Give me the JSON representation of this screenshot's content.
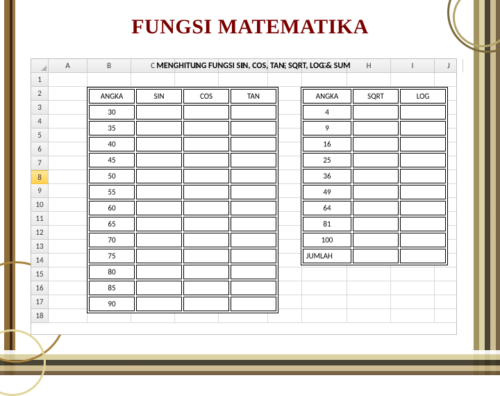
{
  "title": "FUNGSI MATEMATIKA",
  "sheet_subtitle": "MENGHITUNG FUNGSI SIN, COS, TAN, SQRT, LOG & SUM",
  "columns": [
    "A",
    "B",
    "C",
    "D",
    "E",
    "F",
    "G",
    "H",
    "I",
    "J"
  ],
  "rows": [
    "1",
    "2",
    "3",
    "4",
    "5",
    "6",
    "7",
    "8",
    "9",
    "10",
    "11",
    "12",
    "13",
    "14",
    "15",
    "16",
    "17",
    "18"
  ],
  "selected_row": "8",
  "table_left": {
    "headers": [
      "ANGKA",
      "SIN",
      "COS",
      "TAN"
    ],
    "data": [
      "30",
      "35",
      "40",
      "45",
      "50",
      "55",
      "60",
      "65",
      "70",
      "75",
      "80",
      "85",
      "90"
    ]
  },
  "table_right": {
    "headers": [
      "ANGKA",
      "SQRT",
      "LOG"
    ],
    "data": [
      "4",
      "9",
      "16",
      "25",
      "36",
      "49",
      "64",
      "81",
      "100"
    ],
    "footer_label": "JUMLAH"
  }
}
